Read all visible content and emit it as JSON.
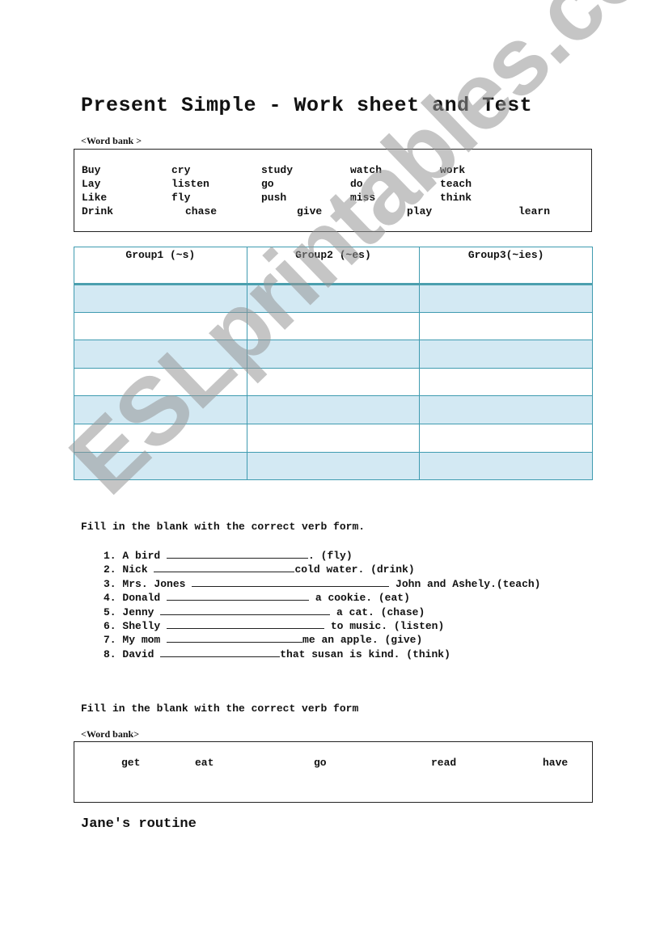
{
  "title": "Present Simple - Work sheet and Test",
  "word_bank_1": {
    "label": "<Word bank >",
    "rows": [
      [
        "Buy",
        "cry",
        "study",
        "watch",
        "work"
      ],
      [
        "Lay",
        "listen",
        "go",
        "do",
        "teach"
      ],
      [
        "Like",
        "fly",
        "push",
        "miss",
        "think"
      ],
      [
        "Drink",
        "chase",
        "give",
        "play",
        "learn"
      ]
    ]
  },
  "group_table": {
    "headers": [
      "Group1 (~s)",
      "Group2 (~es)",
      "Group3(~ies)"
    ],
    "row_count": 7
  },
  "exercise_1": {
    "instruction": "Fill in the blank with the correct verb form.",
    "items": [
      {
        "num": "1.",
        "before": "A bird",
        "after": ". (fly)"
      },
      {
        "num": "2.",
        "before": "Nick",
        "after": "cold water. (drink)"
      },
      {
        "num": "3.",
        "before": "Mrs. Jones",
        "after": " John and Ashely.(teach)"
      },
      {
        "num": "4.",
        "before": "Donald",
        "after": " a cookie. (eat)"
      },
      {
        "num": "5.",
        "before": "Jenny",
        "after": " a cat. (chase)"
      },
      {
        "num": "6.",
        "before": "Shelly",
        "after": " to music. (listen)"
      },
      {
        "num": "7.",
        "before": "My mom",
        "after": "me an apple. (give)"
      },
      {
        "num": "8.",
        "before": "David",
        "after": "that susan is kind. (think)"
      }
    ]
  },
  "exercise_2": {
    "instruction": "Fill in the blank with the correct verb form",
    "word_bank_label": "<Word bank>",
    "words": [
      "get",
      "eat",
      "go",
      "read",
      "have"
    ]
  },
  "routine_title": "Jane's routine",
  "watermark": "ESLprintables.com"
}
